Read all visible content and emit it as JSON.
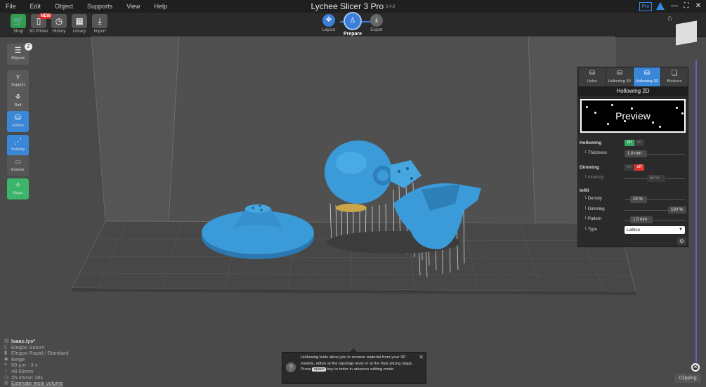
{
  "app": {
    "title": "Lychee Slicer 3 Pro",
    "version": "3.4.8"
  },
  "menu": [
    "File",
    "Edit",
    "Object",
    "Supports",
    "View",
    "Help"
  ],
  "window_controls": {
    "pro_badge": "Pro",
    "minimize": "—",
    "maximize": "⛶",
    "close": "✕"
  },
  "toolbar": {
    "shop": "Shop",
    "printer": "3D Printer",
    "history": "History",
    "library": "Library",
    "import": "Import",
    "new_badge": "NEW"
  },
  "workflow": {
    "layout": "Layout",
    "prepare": "Prepare",
    "export": "Export",
    "active": "Prepare"
  },
  "left_panel": {
    "objects": "Objects",
    "objects_count": "2",
    "support": "Support",
    "raft": "Raft",
    "hollow": "Hollow",
    "visibility": "Visibility",
    "exterior": "Exterior",
    "magic": "Magic"
  },
  "right_panel": {
    "tabs": [
      "Holes",
      "Hollowing 3D",
      "Hollowing 2D",
      "Blockers"
    ],
    "active_tab": "Hollowing 2D",
    "title": "Hollowing 2D",
    "preview_label": "Preview",
    "hollowing_label": "Hollowing",
    "hollowing_on": "on",
    "hollowing_off": "off",
    "thickness_label": "└ Thickness",
    "thickness_value": "1.0 mm",
    "dimming_label": "Dimming",
    "dimming_on": "on",
    "dimming_off": "off",
    "intensity_label": "└ Intensity",
    "intensity_value": "50 %",
    "infill_label": "Infill",
    "density_label": "└ Density",
    "density_value": "10 %",
    "infill_dimming_label": "└ Dimming",
    "infill_dimming_value": "100 %",
    "pattern_label": "└ Pattern",
    "pattern_value": "1.0 mm",
    "type_label": "└ Type",
    "type_value": "Lattice"
  },
  "tooltip": {
    "text": "Hollowing tools allow you to remove material from your 3D models, either at the topology level or at the final slicing stage.",
    "press": "Press",
    "key": "space",
    "rest": "key to enter in advance editing mode"
  },
  "info": {
    "project": "Isaac.lys*",
    "printer": "Elegoo Saturn",
    "resin": "Elegoo Rapid / Standard",
    "color": "Beige",
    "layer": "50 µm - 3 s",
    "height": "48.99mm",
    "time": "2h 45min 18s",
    "estimate": "Estimate resin volume"
  },
  "clipping": "Clipping",
  "colors": {
    "accent": "#3a87d8",
    "model": "#3b9ad8",
    "on": "#33a863",
    "off": "#e03434"
  }
}
